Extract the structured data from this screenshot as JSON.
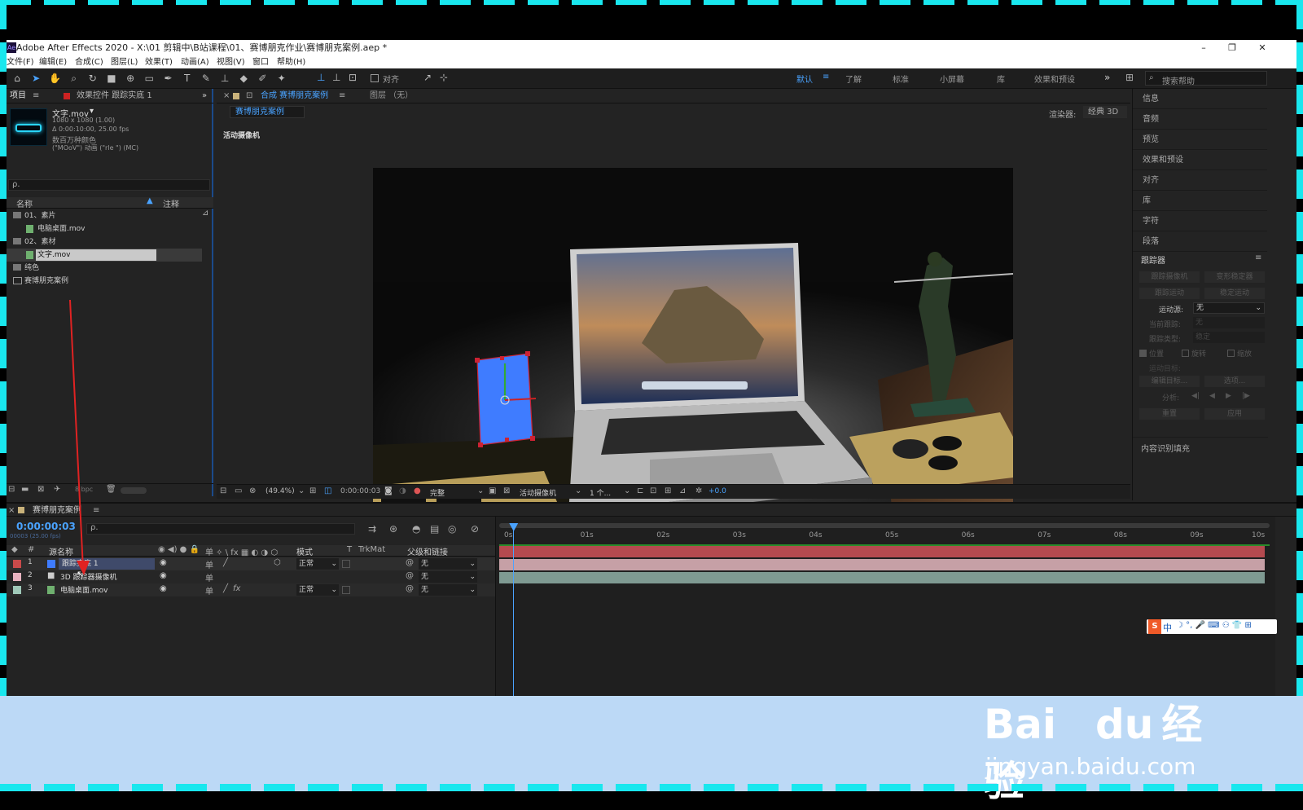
{
  "app": {
    "window_title": "Adobe After Effects 2020 - X:\\01 剪辑中\\B站课程\\01、赛博朋克作业\\赛博朋克案例.aep *",
    "window_controls": [
      "–",
      "❐",
      "✕"
    ]
  },
  "menu": [
    "文件(F)",
    "编辑(E)",
    "合成(C)",
    "图层(L)",
    "效果(T)",
    "动画(A)",
    "视图(V)",
    "窗口",
    "帮助(H)"
  ],
  "toolbar": {
    "align_label": "对齐",
    "workspaces": [
      "默认",
      "了解",
      "标准",
      "小屏幕",
      "库",
      "效果和预设",
      "»"
    ],
    "active_workspace": "默认",
    "search_placeholder": "搜索帮助"
  },
  "project_panel": {
    "tab_label": "项目",
    "tab2_label": "效果控件 跟踪实底 1",
    "asset_name": "文字.mov",
    "asset_info": [
      "1080 x 1080 (1.00)",
      "Δ 0:00:10:00, 25.00 fps",
      "数百万种颜色",
      "(\"MOoV\") 动画 (\"rle \") (MC)"
    ],
    "search_placeholder": "ρ.",
    "col_name": "名称",
    "col_comment": "注释",
    "items": [
      {
        "label": "01、素片",
        "type": "folder"
      },
      {
        "label": "电脑桌面.mov",
        "type": "file"
      },
      {
        "label": "02、素材",
        "type": "folder"
      },
      {
        "label": "文字.mov",
        "type": "file"
      },
      {
        "label": "纯色",
        "type": "folder"
      },
      {
        "label": "赛博朋克案例",
        "type": "comp"
      }
    ],
    "bpc": "8 bpc"
  },
  "comp_panel": {
    "tab_label": "合成 赛博朋克案例",
    "layer_tab": "图层 （无）",
    "comp_name_tag": "赛博朋克案例",
    "renderer_label": "渲染器:",
    "renderer_value": "经典 3D",
    "camera_label": "活动摄像机",
    "zoom": "(49.4%)",
    "timecode": "0:00:00:03",
    "quality": "完整",
    "view_camera": "活动摄像机",
    "views": "1 个...",
    "exposure": "+0.0"
  },
  "right_panel": {
    "items": [
      "信息",
      "音频",
      "预览",
      "效果和预设",
      "对齐",
      "库",
      "字符",
      "段落"
    ],
    "tracker": {
      "title": "跟踪器",
      "buttons": [
        "跟踪摄像机",
        "变形稳定器",
        "跟踪运动",
        "稳定运动"
      ],
      "motion_source_label": "运动源:",
      "motion_source_value": "无",
      "current_track_label": "当前跟踪:",
      "current_track_value": "无",
      "track_type_label": "跟踪类型:",
      "track_type_value": "稳定",
      "checks": [
        "位置",
        "旋转",
        "缩放"
      ],
      "motion_target_label": "运动目标:",
      "edit_target": "编辑目标...",
      "options": "选项...",
      "analyze_label": "分析:",
      "reset": "重置",
      "apply": "应用"
    },
    "content_fill": "内容识别填充"
  },
  "timeline": {
    "tab_label": "赛博朋克案例",
    "timecode": "0:00:00:03",
    "timecode_sub": "00003 (25.00 fps)",
    "col_num": "#",
    "col_source": "源名称",
    "col_mode": "模式",
    "col_t": "T",
    "col_trkmat": "TrkMat",
    "col_parent": "父级和链接",
    "layers": [
      {
        "num": "1",
        "name": "跟踪实底 1",
        "mode": "正常",
        "parent": "无",
        "label_color": "#c94a4a",
        "bar_color": "#b54a4f"
      },
      {
        "num": "2",
        "name": "3D 跟踪器摄像机",
        "mode": "",
        "parent": "无",
        "label_color": "#e8b3c0",
        "bar_color": "#c6a0a6"
      },
      {
        "num": "3",
        "name": "电脑桌面.mov",
        "mode": "正常",
        "parent": "无",
        "label_color": "#9fc8b8",
        "bar_color": "#7f9a92"
      }
    ],
    "ruler": [
      "0s",
      "01s",
      "02s",
      "03s",
      "04s",
      "05s",
      "06s",
      "07s",
      "08s",
      "09s",
      "10s"
    ],
    "playhead_fraction": 0.012
  },
  "watermark": {
    "text_main": "Bai",
    "text_du": "du",
    "text_cn": "经验",
    "url": "jingyan.baidu.com"
  },
  "ime_label": "中"
}
